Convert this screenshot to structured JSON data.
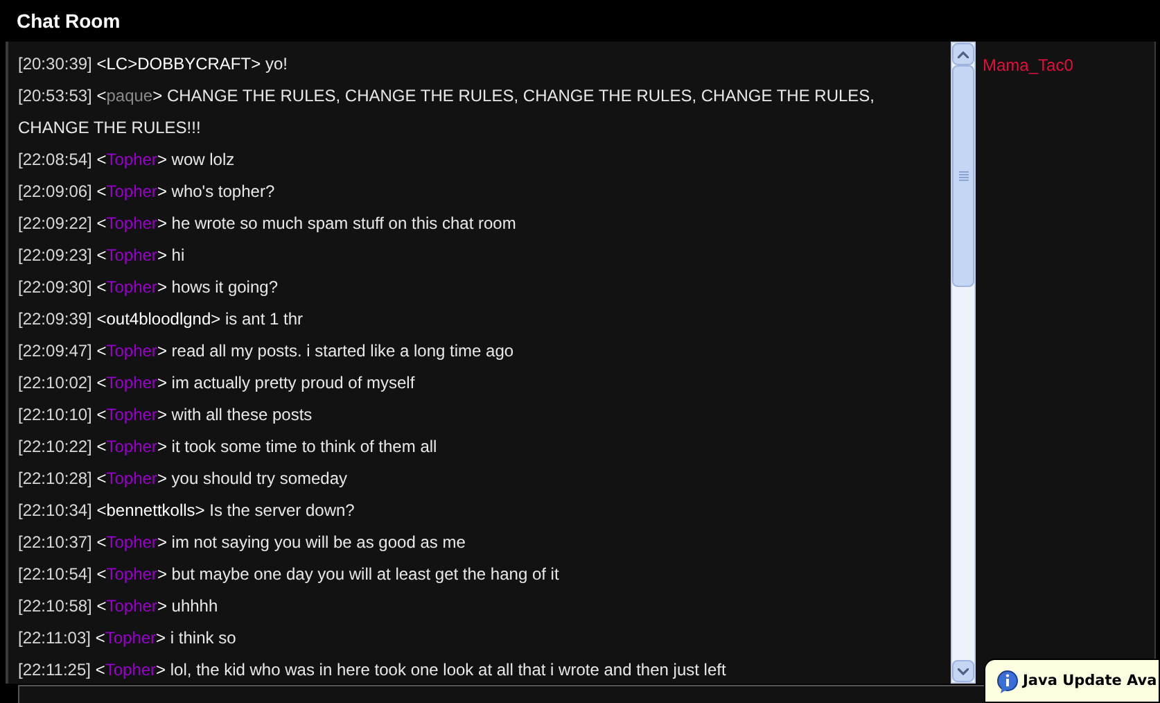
{
  "window": {
    "title": "Chat Room"
  },
  "messages": [
    {
      "time": "[20:30:39]",
      "open": "<",
      "user": "LC>DOBBYCRAFT",
      "close": ">",
      "color": "#ffffff",
      "text": "yo!"
    },
    {
      "time": "[20:53:53]",
      "open": "<",
      "user": "paque",
      "close": ">",
      "color": "#8a8a8a",
      "text": "CHANGE THE RULES, CHANGE THE RULES, CHANGE THE RULES, CHANGE THE RULES, CHANGE THE RULES!!!"
    },
    {
      "time": "[22:08:54]",
      "open": "<",
      "user": "Topher",
      "close": ">",
      "color": "#9900cc",
      "text": "wow lolz"
    },
    {
      "time": "[22:09:06]",
      "open": "<",
      "user": "Topher",
      "close": ">",
      "color": "#9900cc",
      "text": "who's topher?"
    },
    {
      "time": "[22:09:22]",
      "open": "<",
      "user": "Topher",
      "close": ">",
      "color": "#9900cc",
      "text": "he wrote so much spam stuff on this chat room"
    },
    {
      "time": "[22:09:23]",
      "open": "<",
      "user": "Topher",
      "close": ">",
      "color": "#9900cc",
      "text": "hi"
    },
    {
      "time": "[22:09:30]",
      "open": "<",
      "user": "Topher",
      "close": ">",
      "color": "#9900cc",
      "text": "hows it going?"
    },
    {
      "time": "[22:09:39]",
      "open": "<",
      "user": "out4bloodlgnd",
      "close": ">",
      "color": "#ffffff",
      "text": "is ant 1 thr"
    },
    {
      "time": "[22:09:47]",
      "open": "<",
      "user": "Topher",
      "close": ">",
      "color": "#9900cc",
      "text": "read all my posts. i started like a long time ago"
    },
    {
      "time": "[22:10:02]",
      "open": "<",
      "user": "Topher",
      "close": ">",
      "color": "#9900cc",
      "text": "im actually pretty proud of myself"
    },
    {
      "time": "[22:10:10]",
      "open": "<",
      "user": "Topher",
      "close": ">",
      "color": "#9900cc",
      "text": "with all these posts"
    },
    {
      "time": "[22:10:22]",
      "open": "<",
      "user": "Topher",
      "close": ">",
      "color": "#9900cc",
      "text": "it took some time to think of them all"
    },
    {
      "time": "[22:10:28]",
      "open": "<",
      "user": "Topher",
      "close": ">",
      "color": "#9900cc",
      "text": "you should try someday"
    },
    {
      "time": "[22:10:34]",
      "open": "<",
      "user": "bennettkolls",
      "close": ">",
      "color": "#ffffff",
      "text": "Is the server down?"
    },
    {
      "time": "[22:10:37]",
      "open": "<",
      "user": "Topher",
      "close": ">",
      "color": "#9900cc",
      "text": "im not saying you will be as good as me"
    },
    {
      "time": "[22:10:54]",
      "open": "<",
      "user": "Topher",
      "close": ">",
      "color": "#9900cc",
      "text": "but maybe one day you will at least get the hang of it"
    },
    {
      "time": "[22:10:58]",
      "open": "<",
      "user": "Topher",
      "close": ">",
      "color": "#9900cc",
      "text": "uhhhh"
    },
    {
      "time": "[22:11:03]",
      "open": "<",
      "user": "Topher",
      "close": ">",
      "color": "#9900cc",
      "text": "i think so"
    },
    {
      "time": "[22:11:25]",
      "open": "<",
      "user": "Topher",
      "close": ">",
      "color": "#9900cc",
      "text": "lol, the kid who was in here took one look at all that i wrote and then just left"
    }
  ],
  "users": [
    {
      "name": "Mama_Tac0",
      "color": "#e0103a"
    }
  ],
  "notification": {
    "title": "Java Update Ava"
  }
}
